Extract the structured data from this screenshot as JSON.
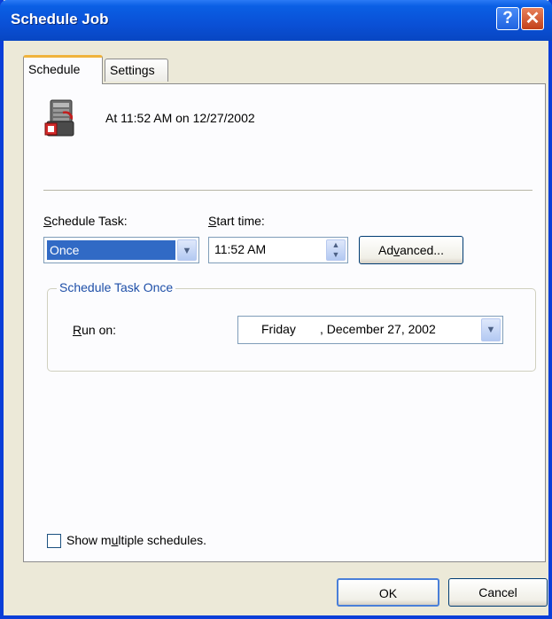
{
  "window": {
    "title": "Schedule Job",
    "help_label": "?",
    "close_label": "✕"
  },
  "tabs": [
    {
      "label": "Schedule",
      "active": true
    },
    {
      "label": "Settings",
      "active": false
    }
  ],
  "summary": {
    "icon": "scheduled-task-icon",
    "text": "At 11:52 AM on 12/27/2002"
  },
  "schedule_task": {
    "label_accel": "S",
    "label_rest": "chedule Task:",
    "value": "Once"
  },
  "start_time": {
    "label_accel": "S",
    "label_rest": "tart time:",
    "value": "11:52 AM"
  },
  "advanced_button": {
    "label_pre": "Ad",
    "label_accel": "v",
    "label_post": "anced..."
  },
  "group": {
    "title": "Schedule Task Once",
    "run_on_accel": "R",
    "run_on_rest": "un on:",
    "day": "Friday",
    "date": ", December 27, 2002"
  },
  "multiple_schedules": {
    "label_pre": "Show m",
    "label_accel": "u",
    "label_post": "ltiple schedules.",
    "checked": false
  },
  "buttons": {
    "ok": "OK",
    "cancel": "Cancel"
  },
  "colors": {
    "title_bar": "#0a50d6",
    "dialog_bg": "#ece9d8",
    "selection": "#316ac5",
    "group_title": "#1e4fa8",
    "tab_highlight": "#f0b33c"
  }
}
